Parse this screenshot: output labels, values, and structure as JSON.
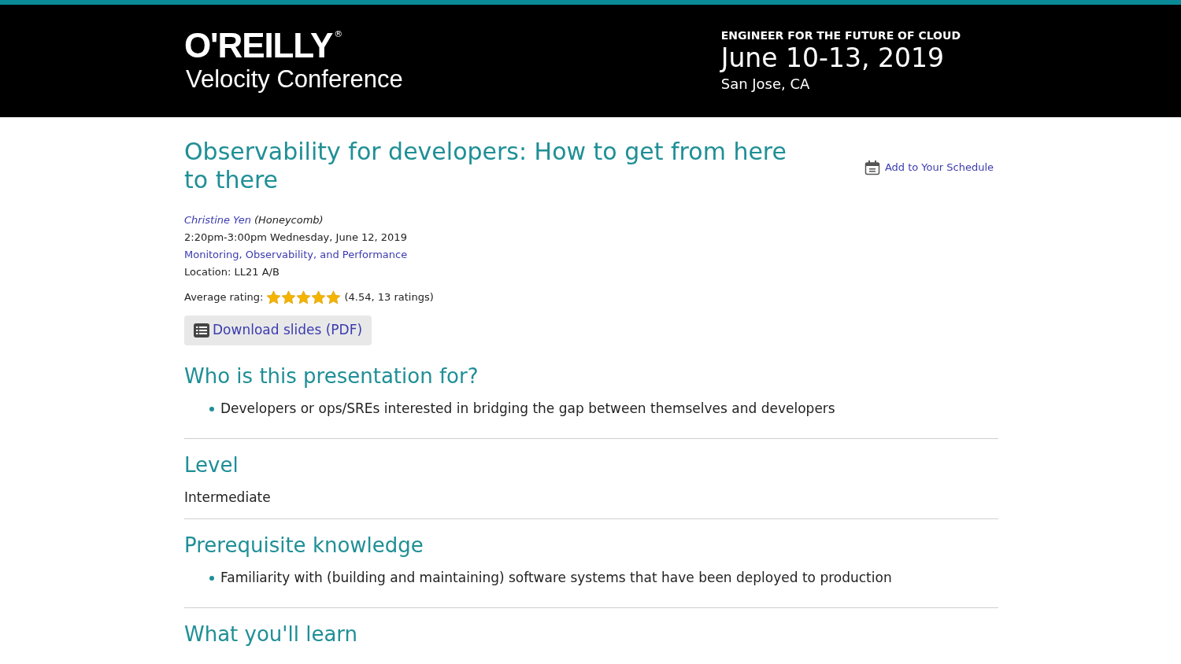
{
  "header": {
    "logo": "O'REILLY",
    "logo_mark": "®",
    "conference": "Velocity Conference",
    "tagline": "ENGINEER FOR THE FUTURE OF CLOUD",
    "dates": "June 10-13, 2019",
    "location": "San Jose, CA"
  },
  "session": {
    "title": "Observability for developers: How to get from here to there",
    "schedule_link": "Add to Your Schedule",
    "speaker": "Christine Yen",
    "company": "(Honeycomb)",
    "time": "2:20pm-3:00pm Wednesday, June 12, 2019",
    "topic": "Monitoring, Observability, and Performance",
    "room": "Location: LL21 A/B",
    "rating_label": "Average rating:",
    "stars": 5,
    "rating_text": "(4.54, 13 ratings)",
    "download": "Download slides (PDF)"
  },
  "sections": [
    {
      "kind": "bullets",
      "heading": "Who is this presentation for?",
      "items": [
        "Developers or ops/SREs interested in bridging the gap between themselves and developers"
      ]
    },
    {
      "kind": "text",
      "heading": "Level",
      "text": "Intermediate"
    },
    {
      "kind": "bullets",
      "heading": "Prerequisite knowledge",
      "items": [
        "Familiarity with (building and maintaining) software systems that have been deployed to production"
      ]
    },
    {
      "kind": "heading",
      "heading": "What you'll learn"
    }
  ]
}
